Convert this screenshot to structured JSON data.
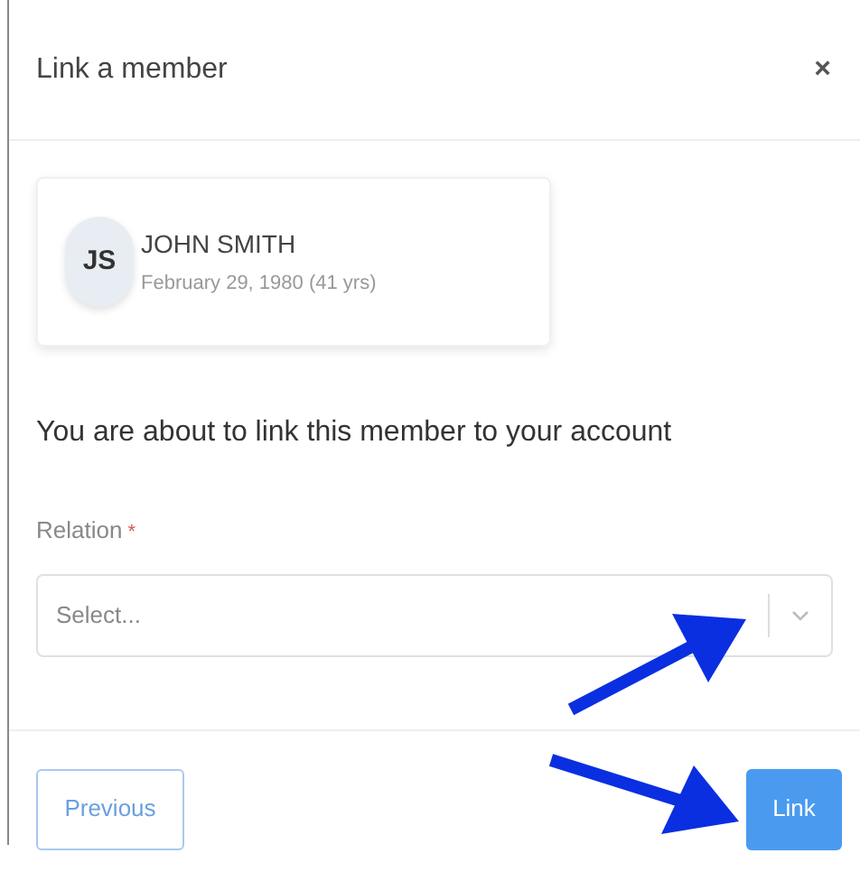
{
  "dialog": {
    "title": "Link a member",
    "close": "×"
  },
  "member": {
    "initials": "JS",
    "name": "JOHN SMITH",
    "birth": "February 29, 1980 (41 yrs)"
  },
  "message": "You are about to link this member to your account",
  "relation": {
    "label": "Relation",
    "required_mark": "*",
    "placeholder": "Select..."
  },
  "buttons": {
    "previous": "Previous",
    "link": "Link"
  }
}
